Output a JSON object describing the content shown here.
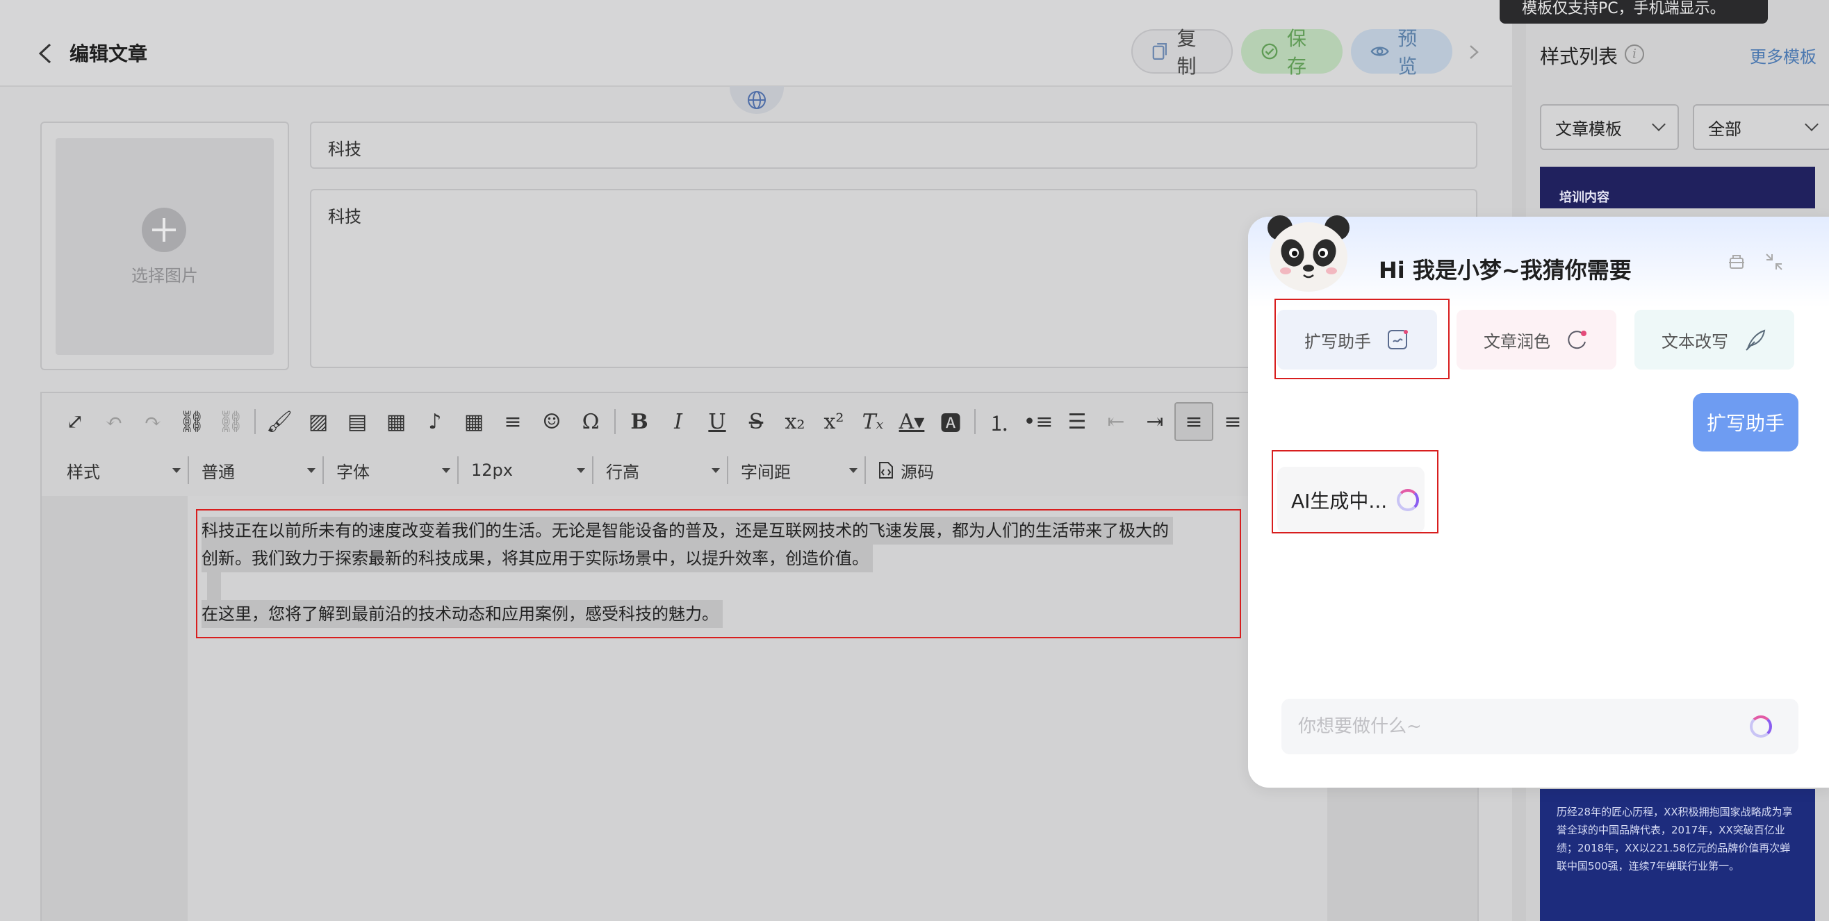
{
  "header": {
    "title": "编辑文章",
    "copy_label": "复制",
    "save_label": "保存",
    "preview_label": "预览"
  },
  "cover": {
    "label": "选择图片"
  },
  "form": {
    "title_value": "科技",
    "summary_value": "科技"
  },
  "toolbar": {
    "style_label": "样式",
    "paragraph_label": "普通",
    "font_label": "字体",
    "size_label": "12px",
    "line_height_label": "行高",
    "letter_spacing_label": "字间距",
    "source_label": "源码"
  },
  "document": {
    "line1": "科技正在以前所未有的速度改变着我们的生活。无论是智能设备的普及，还是互联网技术的飞速发展，都为人们的生活带来了极大的",
    "line2": "创新。我们致力于探索最新的科技成果，将其应用于实际场景中，以提升效率，创造价值。",
    "line3": "在这里，您将了解到最前沿的技术动态和应用案例，感受科技的魅力。"
  },
  "right_panel": {
    "tooltip": "模板仅支持PC，手机端显示。",
    "title": "样式列表",
    "more_label": "更多模板",
    "type_select": "文章模板",
    "filter_select": "全部",
    "thumb_top_label": "培训内容",
    "thumb_bottom_text": "历经28年的匠心历程，XX积极拥抱国家战略成为享誉全球的中国品牌代表，2017年，XX突破百亿业绩；2018年，XX以221.58亿元的品牌价值再次蝉联中国500强，连续7年蝉联行业第一。"
  },
  "ai": {
    "greeting": "Hi 我是小梦~我猜你需要",
    "quick_actions": [
      {
        "label": "扩写助手"
      },
      {
        "label": "文章润色"
      },
      {
        "label": "文本改写"
      }
    ],
    "user_message": "扩写助手",
    "status_message": "AI生成中...",
    "input_placeholder": "你想要做什么~"
  },
  "colors": {
    "accent_blue": "#6e9cf2",
    "save_green": "#5f9b55",
    "highlight_red": "#d81e1e"
  }
}
